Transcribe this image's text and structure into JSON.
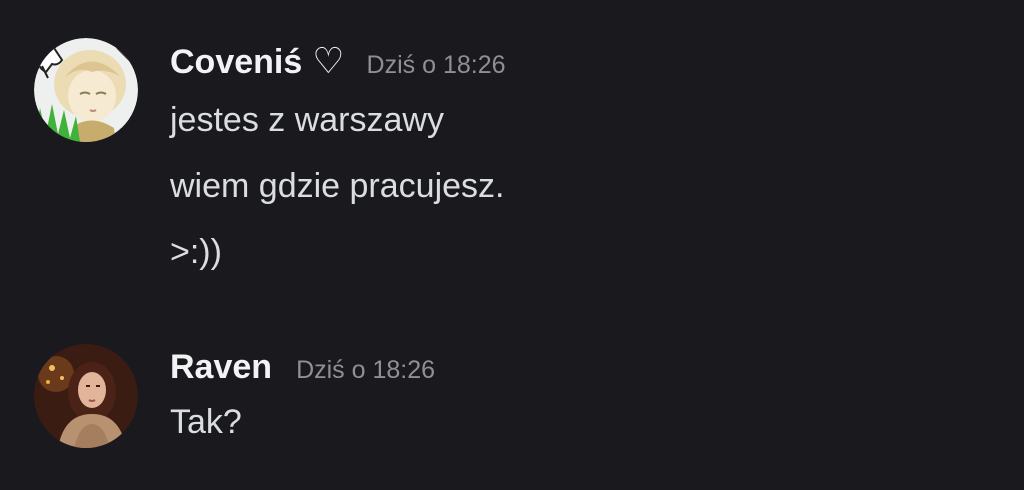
{
  "messages": [
    {
      "author": "Coveniś",
      "author_suffix": "♡",
      "timestamp": "Dziś o 18:26",
      "lines": [
        "jestes z warszawy",
        "wiem gdzie pracujesz.",
        ">:))"
      ]
    },
    {
      "author": "Raven",
      "timestamp": "Dziś o 18:26",
      "lines": [
        "Tak?"
      ]
    }
  ],
  "colors": {
    "background": "#1a1a1e",
    "username": "#f2f3f5",
    "message_text": "#dbdee1",
    "timestamp": "#8e9097"
  }
}
